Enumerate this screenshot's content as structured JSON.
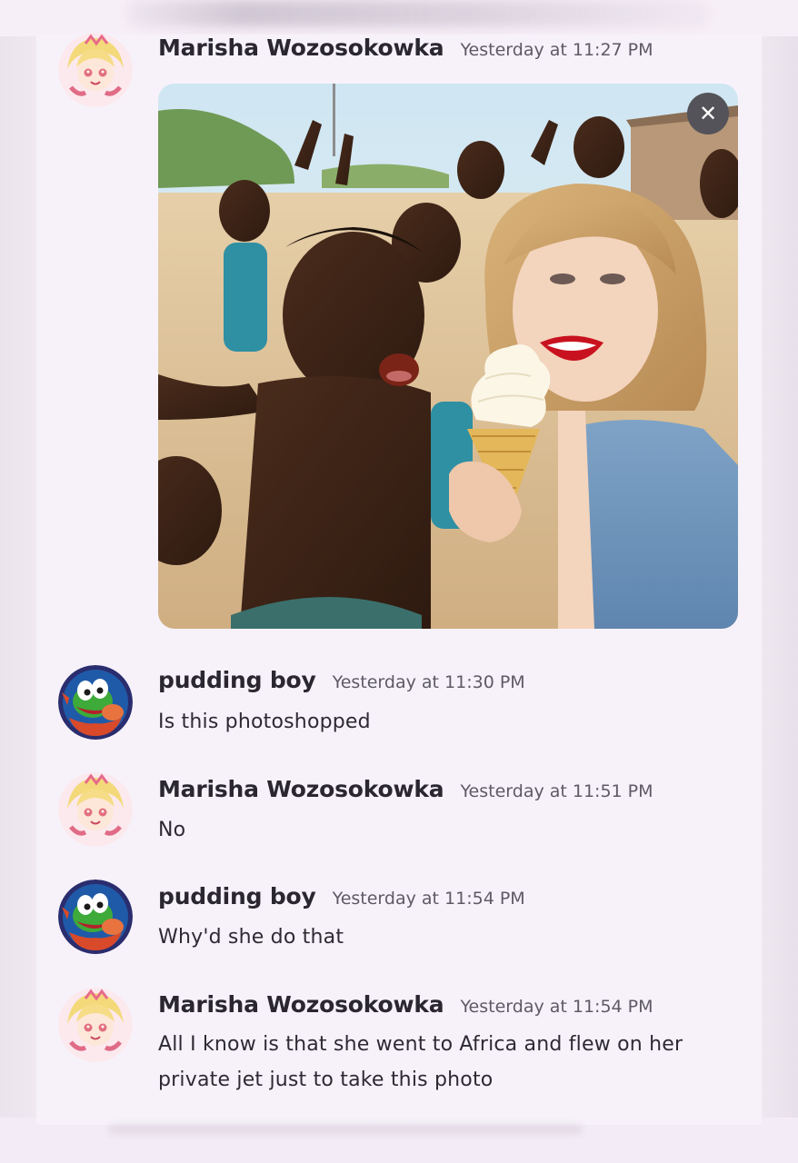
{
  "messages": [
    {
      "author": "Marisha Wozosokowka",
      "timestamp": "Yesterday at 11:27 PM",
      "text": "",
      "has_image": true,
      "close_glyph": "✕"
    },
    {
      "author": "pudding boy",
      "timestamp": "Yesterday at 11:30 PM",
      "text": "Is this photoshopped"
    },
    {
      "author": "Marisha Wozosokowka",
      "timestamp": "Yesterday at 11:51 PM",
      "text": "No"
    },
    {
      "author": "pudding boy",
      "timestamp": "Yesterday at 11:54 PM",
      "text": "Why'd she do that"
    },
    {
      "author": "Marisha Wozosokowka",
      "timestamp": "Yesterday at 11:54 PM",
      "text_line1": "All I know is that she went to Africa and flew on her",
      "text_line2": "private jet just to take this photo"
    }
  ],
  "colors": {
    "author": "#2a2730",
    "timestamp": "#5d5a66",
    "background": "#f7f2fa"
  }
}
